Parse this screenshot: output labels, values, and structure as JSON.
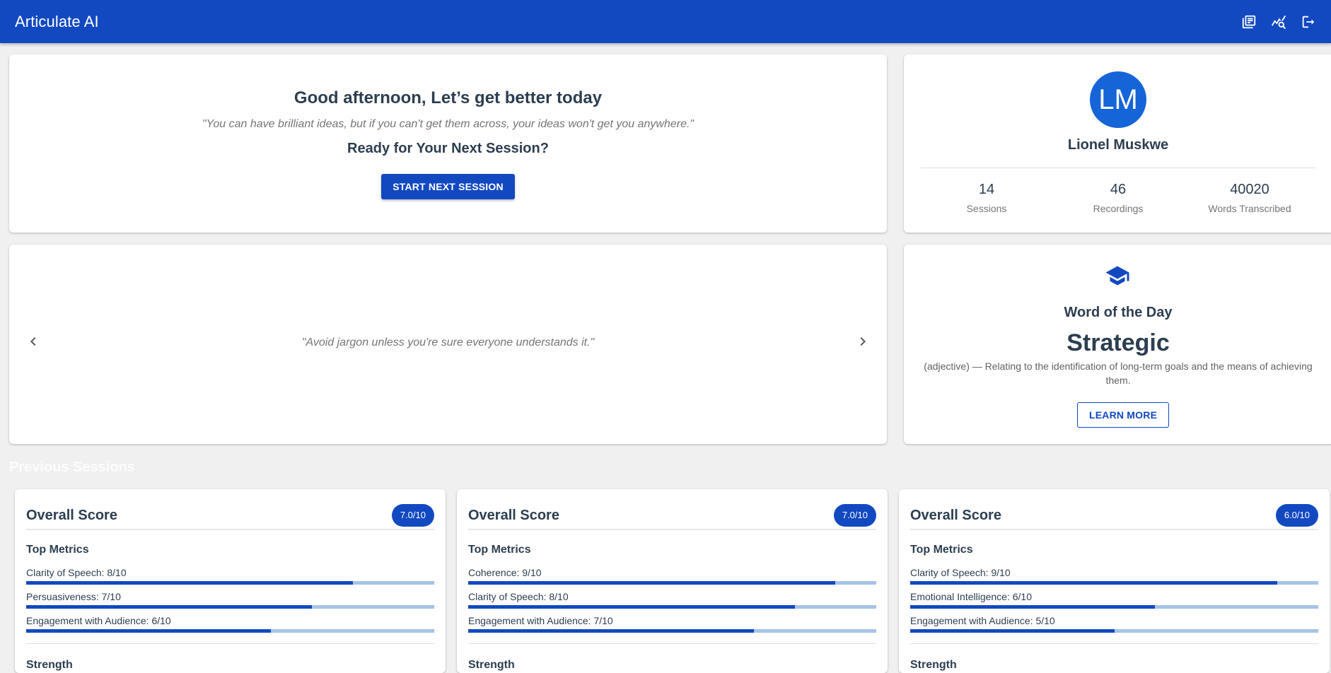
{
  "appbar": {
    "title": "Articulate AI",
    "icons": [
      "library-books-icon",
      "query-stats-icon",
      "logout-icon"
    ]
  },
  "welcome": {
    "greeting": "Good afternoon, Let’s get better today",
    "quote": "\"You can have brilliant ideas, but if you can't get them across, your ideas won't get you anywhere.\"",
    "subtitle": "Ready for Your Next Session?",
    "button": "START NEXT SESSION"
  },
  "profile": {
    "initials": "LM",
    "name": "Lionel Muskwe",
    "stats": [
      {
        "value": "14",
        "label": "Sessions"
      },
      {
        "value": "46",
        "label": "Recordings"
      },
      {
        "value": "40020",
        "label": "Words Transcribed"
      }
    ]
  },
  "carousel": {
    "tip": "\"Avoid jargon unless you're sure everyone understands it.\""
  },
  "word_of_day": {
    "title": "Word of the Day",
    "word": "Strategic",
    "definition": "(adjective) — Relating to the identification of long-term goals and the means of achieving them.",
    "button": "LEARN MORE"
  },
  "previous_sessions": {
    "title": "Previous Sessions",
    "sessions": [
      {
        "title": "Overall Score",
        "score": "7.0/10",
        "top_metrics_label": "Top Metrics",
        "metrics": [
          {
            "label": "Clarity of Speech: 8/10",
            "value": 0.8
          },
          {
            "label": "Persuasiveness: 7/10",
            "value": 0.7
          },
          {
            "label": "Engagement with Audience: 6/10",
            "value": 0.6
          }
        ],
        "strength_label": "Strength"
      },
      {
        "title": "Overall Score",
        "score": "7.0/10",
        "top_metrics_label": "Top Metrics",
        "metrics": [
          {
            "label": "Coherence: 9/10",
            "value": 0.9
          },
          {
            "label": "Clarity of Speech: 8/10",
            "value": 0.8
          },
          {
            "label": "Engagement with Audience: 7/10",
            "value": 0.7
          }
        ],
        "strength_label": "Strength"
      },
      {
        "title": "Overall Score",
        "score": "6.0/10",
        "top_metrics_label": "Top Metrics",
        "metrics": [
          {
            "label": "Clarity of Speech: 9/10",
            "value": 0.9
          },
          {
            "label": "Emotional Intelligence: 6/10",
            "value": 0.6
          },
          {
            "label": "Engagement with Audience: 5/10",
            "value": 0.5
          }
        ],
        "strength_label": "Strength"
      }
    ]
  },
  "colors": {
    "primary": "#1249c1",
    "bar_track": "#a6c3ea",
    "avatar": "#1565d8"
  }
}
